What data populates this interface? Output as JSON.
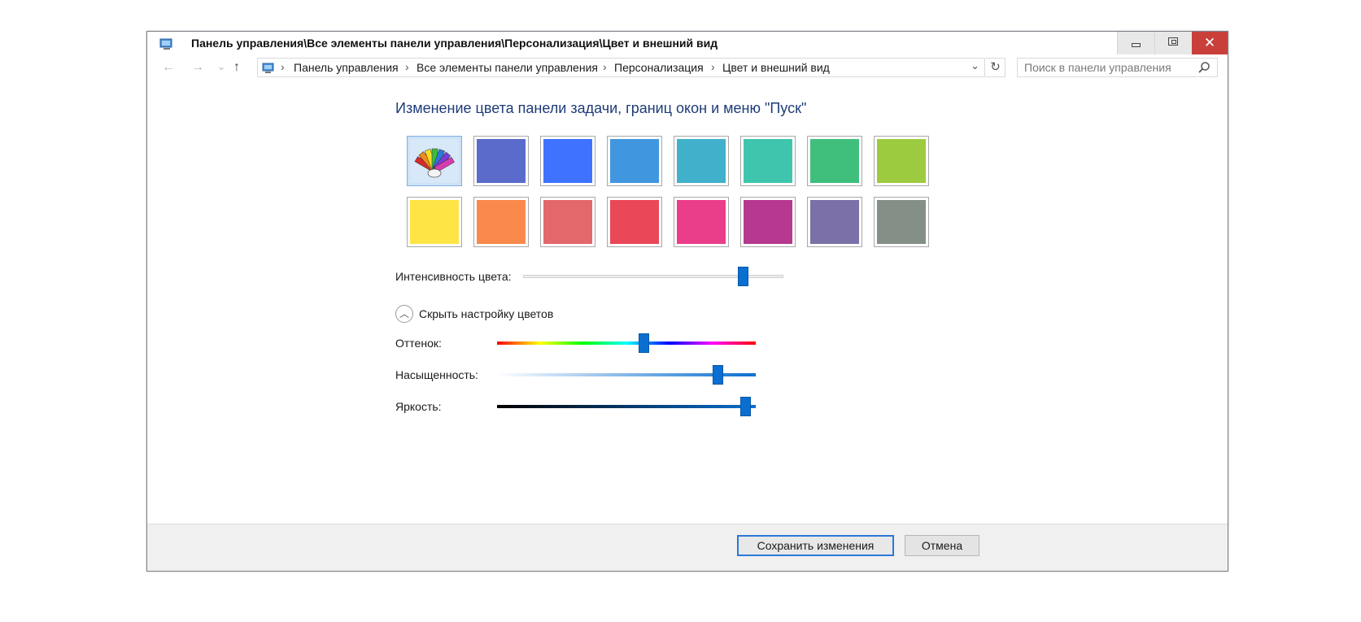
{
  "window": {
    "title": "Панель управления\\Все элементы панели управления\\Персонализация\\Цвет и внешний вид",
    "title_icon": "control-panel-icon",
    "controls": {
      "minimize": "minimize-icon",
      "maximize": "maximize-icon",
      "close": "✕"
    }
  },
  "nav": {
    "back": "←",
    "forward": "→",
    "recent": "⌄",
    "up": "↑",
    "breadcrumb": [
      "Панель управления",
      "Все элементы панели управления",
      "Персонализация",
      "Цвет и внешний вид"
    ],
    "separator": "›",
    "dropdown": "⌄",
    "refresh": "↻"
  },
  "search": {
    "placeholder": "Поиск в панели управления",
    "icon": "search-icon"
  },
  "main": {
    "heading": "Изменение цвета панели задачи, границ окон и меню \"Пуск\"",
    "swatches": [
      {
        "name": "auto",
        "color": "#d7e8f8",
        "icon": "color-palette-icon",
        "selected": true
      },
      {
        "name": "indigo",
        "color": "#5a6bcc"
      },
      {
        "name": "blue",
        "color": "#3f73ff"
      },
      {
        "name": "sky-blue",
        "color": "#4196e0"
      },
      {
        "name": "cyan",
        "color": "#41b0cb"
      },
      {
        "name": "teal",
        "color": "#3fc5ae"
      },
      {
        "name": "green",
        "color": "#3fbf7b"
      },
      {
        "name": "lime",
        "color": "#9dcb3f"
      },
      {
        "name": "yellow",
        "color": "#ffe445"
      },
      {
        "name": "orange",
        "color": "#f98a4b"
      },
      {
        "name": "salmon",
        "color": "#e2686b"
      },
      {
        "name": "red",
        "color": "#ea4858"
      },
      {
        "name": "pink",
        "color": "#ea3e8b"
      },
      {
        "name": "magenta",
        "color": "#b6388f"
      },
      {
        "name": "purple",
        "color": "#7b70a8"
      },
      {
        "name": "gray",
        "color": "#848f87"
      }
    ],
    "intensity_label": "Интенсивность цвета:",
    "intensity_value": 0.86,
    "toggle_label": "Скрыть настройку цветов",
    "hue_label": "Оттенок:",
    "hue_value": 0.57,
    "saturation_label": "Насыщенность:",
    "saturation_value": 0.87,
    "brightness_label": "Яркость:",
    "brightness_value": 0.98
  },
  "footer": {
    "save_label": "Сохранить изменения",
    "cancel_label": "Отмена"
  }
}
